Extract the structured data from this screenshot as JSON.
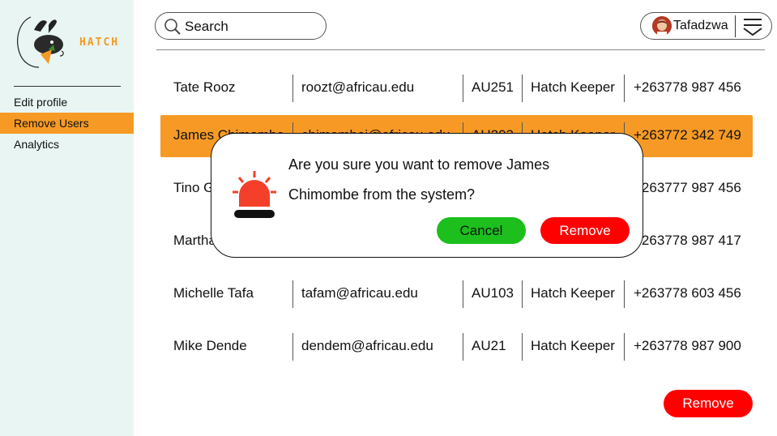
{
  "brand": {
    "logo_text": "HATCH",
    "accent": "#f69a25"
  },
  "sidebar": {
    "items": [
      {
        "label": "Edit profile",
        "active": false
      },
      {
        "label": "Remove Users",
        "active": true
      },
      {
        "label": "Analytics",
        "active": false
      }
    ]
  },
  "header": {
    "search": {
      "placeholder": "Search",
      "icon": "search-icon"
    },
    "user": {
      "name": "Tafadzwa",
      "menu_icon": "chevron-menu-icon"
    }
  },
  "users": [
    {
      "name": "Tate Rooz",
      "email": "roozt@africau.edu",
      "id": "AU251",
      "role": "Hatch Keeper",
      "phone": "+263778 987 456",
      "selected": false
    },
    {
      "name": "James Chimombe",
      "email": "chimombej@africau.edu",
      "id": "AU203",
      "role": "Hatch Keeper",
      "phone": "+263772 342 749",
      "selected": true
    },
    {
      "name": "Tino Gumbo",
      "email": "",
      "id": "",
      "role": "",
      "phone": "+263777 987 456",
      "selected": false
    },
    {
      "name": "Martha",
      "email": "",
      "id": "",
      "role": "",
      "phone": "+263778 987 417",
      "selected": false
    },
    {
      "name": "Michelle Tafa",
      "email": "tafam@africau.edu",
      "id": "AU103",
      "role": "Hatch Keeper",
      "phone": "+263778 603 456",
      "selected": false
    },
    {
      "name": "Mike Dende",
      "email": "dendem@africau.edu",
      "id": "AU21",
      "role": "Hatch Keeper",
      "phone": "+263778 987 900",
      "selected": false
    }
  ],
  "actions": {
    "remove_label": "Remove"
  },
  "dialog": {
    "line1": "Are you sure you want to remove James",
    "line2": "Chimombe from the system?",
    "cancel_label": "Cancel",
    "confirm_label": "Remove",
    "icon": "alarm-icon"
  },
  "colors": {
    "danger": "#ff0000",
    "success": "#1cbf1c",
    "sidebar_bg": "#e8f5f2"
  }
}
